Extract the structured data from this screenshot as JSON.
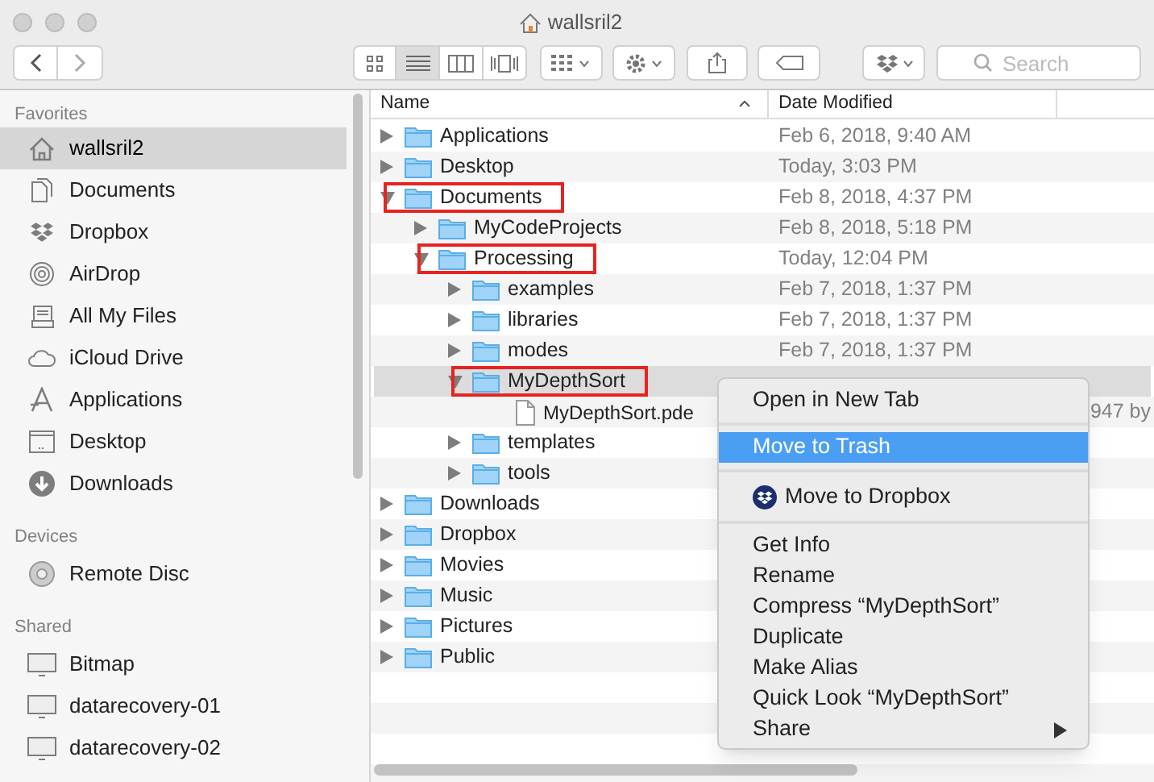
{
  "window": {
    "title": "wallsril2"
  },
  "toolbar": {
    "view_modes": [
      {
        "selected": false
      },
      {
        "selected": true
      },
      {
        "selected": false
      },
      {
        "selected": false
      }
    ],
    "search": {
      "placeholder": "Search"
    }
  },
  "sidebar": {
    "sections": [
      {
        "header": "Favorites",
        "items": [
          {
            "label": "wallsril2",
            "selected": true
          },
          {
            "label": "Documents",
            "selected": false
          },
          {
            "label": "Dropbox",
            "selected": false
          },
          {
            "label": "AirDrop",
            "selected": false
          },
          {
            "label": "All My Files",
            "selected": false
          },
          {
            "label": "iCloud Drive",
            "selected": false
          },
          {
            "label": "Applications",
            "selected": false
          },
          {
            "label": "Desktop",
            "selected": false
          },
          {
            "label": "Downloads",
            "selected": false
          }
        ]
      },
      {
        "header": "Devices",
        "items": [
          {
            "label": "Remote Disc",
            "selected": false
          }
        ]
      },
      {
        "header": "Shared",
        "items": [
          {
            "label": "Bitmap",
            "selected": false
          },
          {
            "label": "datarecovery-01",
            "selected": false
          },
          {
            "label": "datarecovery-02",
            "selected": false
          }
        ]
      }
    ]
  },
  "table": {
    "columns": [
      "Name",
      "Date Modified"
    ],
    "rows": [
      {
        "kind": "folder",
        "name": "Applications",
        "date": "Feb 6, 2018, 9:40 AM",
        "expanded": false,
        "selected": false,
        "outlined": false
      },
      {
        "kind": "folder",
        "name": "Desktop",
        "date": "Today, 3:03 PM",
        "expanded": false,
        "selected": false,
        "outlined": false
      },
      {
        "kind": "folder",
        "name": "Documents",
        "date": "Feb 8, 2018, 4:37 PM",
        "expanded": true,
        "selected": false,
        "outlined": true,
        "children": [
          {
            "kind": "folder",
            "name": "MyCodeProjects",
            "date": "Feb 8, 2018, 5:18 PM",
            "expanded": false,
            "selected": false,
            "outlined": false
          },
          {
            "kind": "folder",
            "name": "Processing",
            "date": "Today, 12:04 PM",
            "expanded": true,
            "selected": false,
            "outlined": true,
            "children": [
              {
                "kind": "folder",
                "name": "examples",
                "date": "Feb 7, 2018, 1:37 PM",
                "expanded": false,
                "selected": false,
                "outlined": false
              },
              {
                "kind": "folder",
                "name": "libraries",
                "date": "Feb 7, 2018, 1:37 PM",
                "expanded": false,
                "selected": false,
                "outlined": false
              },
              {
                "kind": "folder",
                "name": "modes",
                "date": "Feb 7, 2018, 1:37 PM",
                "expanded": false,
                "selected": false,
                "outlined": false
              },
              {
                "kind": "folder",
                "name": "MyDepthSort",
                "expanded": true,
                "selected": true,
                "outlined": true,
                "children": [
                  {
                    "kind": "file",
                    "name": "MyDepthSort.pde",
                    "size": "947 by",
                    "selected": false,
                    "outlined": false
                  }
                ]
              },
              {
                "kind": "folder",
                "name": "templates",
                "expanded": false,
                "selected": false,
                "outlined": false
              },
              {
                "kind": "folder",
                "name": "tools",
                "expanded": false,
                "selected": false,
                "outlined": false
              }
            ]
          }
        ]
      },
      {
        "kind": "folder",
        "name": "Downloads",
        "expanded": false,
        "selected": false,
        "outlined": false
      },
      {
        "kind": "folder",
        "name": "Dropbox",
        "expanded": false,
        "selected": false,
        "outlined": false
      },
      {
        "kind": "folder",
        "name": "Movies",
        "expanded": false,
        "selected": false,
        "outlined": false
      },
      {
        "kind": "folder",
        "name": "Music",
        "expanded": false,
        "selected": false,
        "outlined": false
      },
      {
        "kind": "folder",
        "name": "Pictures",
        "expanded": false,
        "selected": false,
        "outlined": false
      },
      {
        "kind": "folder",
        "name": "Public",
        "expanded": false,
        "selected": false,
        "outlined": false
      }
    ]
  },
  "context_menu": {
    "groups": [
      [
        {
          "label": "Open in New Tab",
          "selected": false
        }
      ],
      [
        {
          "label": "Move to Trash",
          "selected": true
        }
      ],
      [
        {
          "label": "Move to Dropbox",
          "selected": false,
          "kind": "dropbox"
        }
      ],
      [
        {
          "label": "Get Info",
          "selected": false
        },
        {
          "label": "Rename",
          "selected": false
        },
        {
          "label": "Compress “MyDepthSort”",
          "selected": false
        },
        {
          "label": "Duplicate",
          "selected": false
        },
        {
          "label": "Make Alias",
          "selected": false
        },
        {
          "label": "Quick Look “MyDepthSort”",
          "selected": false
        },
        {
          "label": "Share",
          "selected": false,
          "kind": "submenu"
        }
      ]
    ]
  }
}
